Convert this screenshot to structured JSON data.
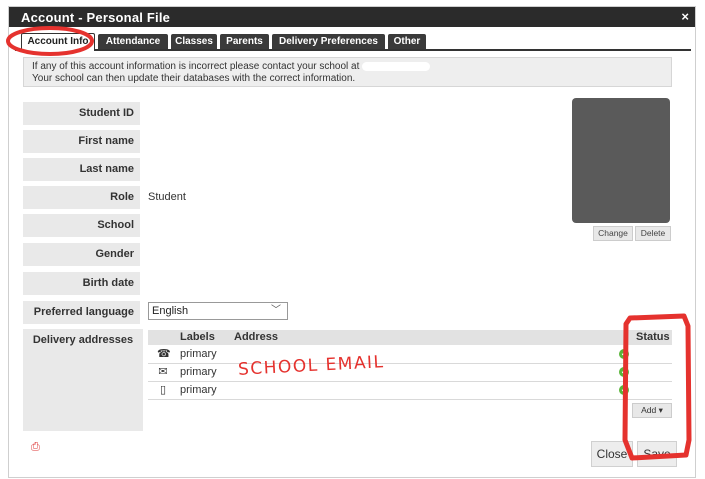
{
  "window": {
    "title": "Account - Personal File",
    "close_symbol": "×"
  },
  "tabs": [
    {
      "label": "Account Info",
      "active": true
    },
    {
      "label": "Attendance"
    },
    {
      "label": "Classes"
    },
    {
      "label": "Parents"
    },
    {
      "label": "Delivery Preferences"
    },
    {
      "label": "Other"
    }
  ],
  "notice": {
    "line1": "If any of this account information is incorrect please contact your school at",
    "line2": "Your school can then update their databases with the correct information."
  },
  "fields": [
    {
      "label": "Student ID",
      "value": ""
    },
    {
      "label": "First name",
      "value": ""
    },
    {
      "label": "Last name",
      "value": ""
    },
    {
      "label": "Role",
      "value": "Student"
    },
    {
      "label": "School",
      "value": ""
    },
    {
      "label": "Gender",
      "value": ""
    },
    {
      "label": "Birth date",
      "value": ""
    }
  ],
  "photo": {
    "change_label": "Change",
    "delete_label": "Delete"
  },
  "language": {
    "label": "Preferred language",
    "value": "English"
  },
  "delivery": {
    "label": "Delivery addresses",
    "headers": {
      "labels": "Labels",
      "address": "Address",
      "status": "Status"
    },
    "rows": [
      {
        "icon": "phone-icon",
        "label": "primary",
        "status": "check-icon"
      },
      {
        "icon": "envelope-icon",
        "label": "primary",
        "status": "check-icon"
      },
      {
        "icon": "mobile-icon",
        "label": "primary",
        "status": "check-icon"
      }
    ],
    "add_label": "Add ▾"
  },
  "buttons": {
    "close": "Close",
    "save": "Save"
  },
  "annotations": {
    "handwritten": "SCHOOL EMAIL"
  },
  "colors": {
    "accent_red": "#e5322e",
    "titlebar": "#2b2b2b",
    "status_green": "#5ab53a"
  }
}
